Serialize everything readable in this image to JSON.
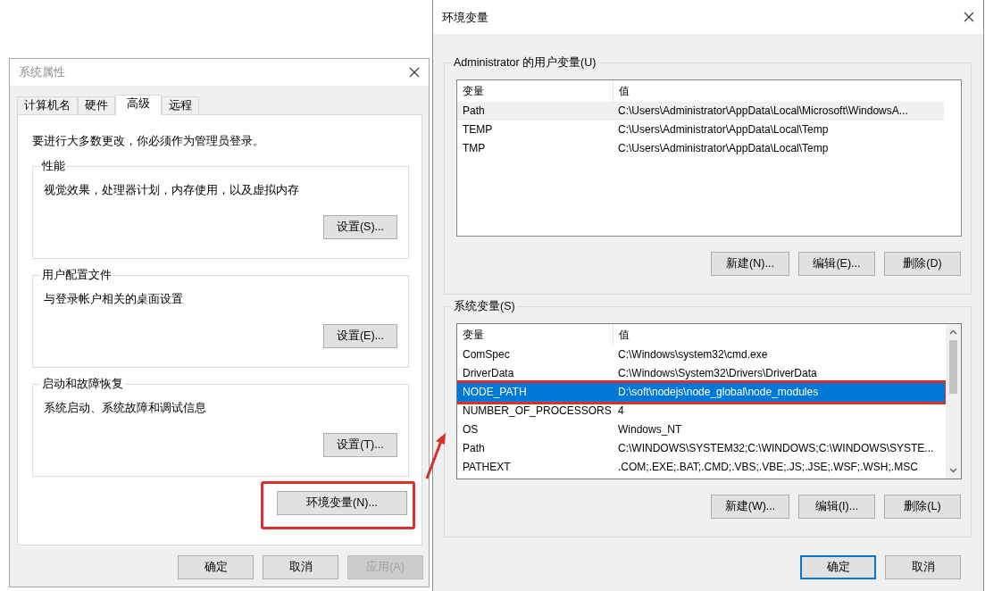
{
  "system_properties": {
    "title": "系统属性",
    "tabs": [
      {
        "label": "计算机名",
        "selected": false
      },
      {
        "label": "硬件",
        "selected": false
      },
      {
        "label": "高级",
        "selected": true
      },
      {
        "label": "远程",
        "selected": false
      }
    ],
    "notice": "要进行大多数更改，你必须作为管理员登录。",
    "groups": [
      {
        "title": "性能",
        "description": "视觉效果，处理器计划，内存使用，以及虚拟内存",
        "button": "设置(S)..."
      },
      {
        "title": "用户配置文件",
        "description": "与登录帐户相关的桌面设置",
        "button": "设置(E)..."
      },
      {
        "title": "启动和故障恢复",
        "description": "系统启动、系统故障和调试信息",
        "button": "设置(T)..."
      }
    ],
    "env_button": {
      "label": "环境变量(N)...",
      "highlighted": true
    },
    "buttons": [
      {
        "label": "确定",
        "disabled": false
      },
      {
        "label": "取消",
        "disabled": false
      },
      {
        "label": "应用(A)",
        "disabled": true
      }
    ]
  },
  "environment_variables": {
    "title": "环境变量",
    "sections": [
      {
        "title": "Administrator 的用户变量(U)",
        "focused": false,
        "columns": [
          "变量",
          "值"
        ],
        "rows": [
          {
            "name": "Path",
            "value": "C:\\Users\\Administrator\\AppData\\Local\\Microsoft\\WindowsA...",
            "selected": true,
            "highlighted": false
          },
          {
            "name": "TEMP",
            "value": "C:\\Users\\Administrator\\AppData\\Local\\Temp",
            "selected": false,
            "highlighted": false
          },
          {
            "name": "TMP",
            "value": "C:\\Users\\Administrator\\AppData\\Local\\Temp",
            "selected": false,
            "highlighted": false
          }
        ],
        "buttons": [
          "新建(N)...",
          "编辑(E)...",
          "删除(D)"
        ]
      },
      {
        "title": "系统变量(S)",
        "focused": true,
        "columns": [
          "变量",
          "值"
        ],
        "rows": [
          {
            "name": "ComSpec",
            "value": "C:\\Windows\\system32\\cmd.exe",
            "selected": false,
            "highlighted": false
          },
          {
            "name": "DriverData",
            "value": "C:\\Windows\\System32\\Drivers\\DriverData",
            "selected": false,
            "highlighted": false
          },
          {
            "name": "NODE_PATH",
            "value": "D:\\soft\\nodejs\\node_global\\node_modules",
            "selected": true,
            "highlighted": true
          },
          {
            "name": "NUMBER_OF_PROCESSORS",
            "value": "4",
            "selected": false,
            "highlighted": false
          },
          {
            "name": "OS",
            "value": "Windows_NT",
            "selected": false,
            "highlighted": false
          },
          {
            "name": "Path",
            "value": "C:\\WINDOWS\\SYSTEM32;C:\\WINDOWS;C:\\WINDOWS\\SYSTE...",
            "selected": false,
            "highlighted": false
          },
          {
            "name": "PATHEXT",
            "value": ".COM;.EXE;.BAT;.CMD;.VBS;.VBE;.JS;.JSE;.WSF;.WSH;.MSC",
            "selected": false,
            "highlighted": false
          }
        ],
        "buttons": [
          "新建(W)...",
          "编辑(I)...",
          "删除(L)"
        ]
      }
    ],
    "buttons": [
      {
        "label": "确定",
        "default": true
      },
      {
        "label": "取消",
        "default": false
      }
    ]
  }
}
